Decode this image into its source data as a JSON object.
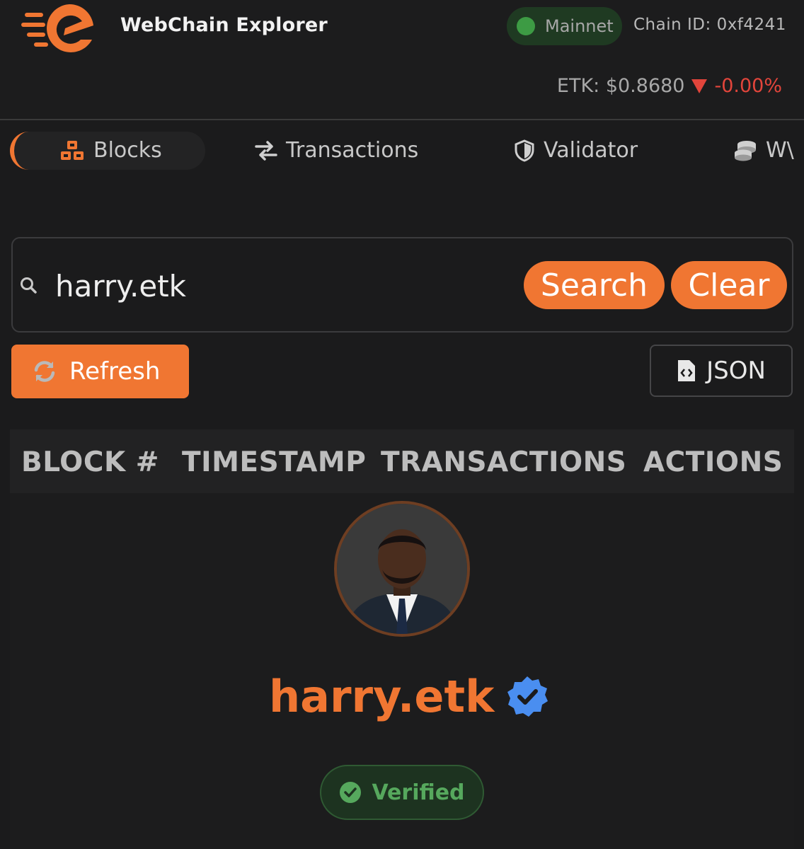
{
  "header": {
    "brand": "WebChain Explorer",
    "network": "Mainnet",
    "chain_id": "Chain ID: 0xf4241",
    "price_label": "ETK: $0.8680",
    "price_change": "-0.00%",
    "logo_icon": "webchain-logo",
    "trend_icon": "down-triangle-icon"
  },
  "nav": {
    "items": [
      {
        "label": "Blocks",
        "icon": "cubes-icon",
        "active": true
      },
      {
        "label": "Transactions",
        "icon": "exchange-icon",
        "active": false
      },
      {
        "label": "Validator",
        "icon": "shield-icon",
        "active": false
      },
      {
        "label": "W\\",
        "icon": "coins-icon",
        "active": false
      }
    ]
  },
  "search": {
    "value": "harry.etk",
    "search_label": "Search",
    "clear_label": "Clear"
  },
  "actions": {
    "refresh_label": "Refresh",
    "json_label": "JSON"
  },
  "table": {
    "columns": [
      "BLOCK #",
      "TIMESTAMP",
      "TRANSACTIONS",
      "ACTIONS"
    ]
  },
  "profile": {
    "username": "harry.etk",
    "status": "Verified"
  },
  "colors": {
    "accent": "#f07632",
    "background": "#1b1b1c",
    "success": "#56a85d",
    "danger": "#e2453b"
  }
}
